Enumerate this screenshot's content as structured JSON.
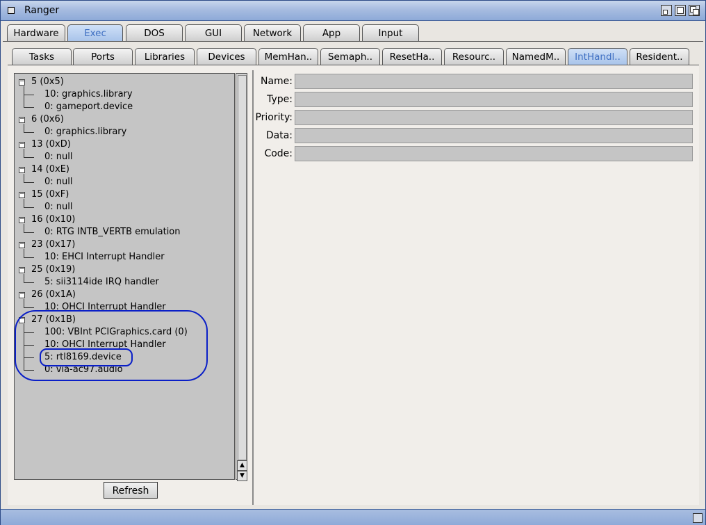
{
  "window": {
    "title": "Ranger"
  },
  "main_tabs": [
    {
      "label": "Hardware"
    },
    {
      "label": "Exec"
    },
    {
      "label": "DOS"
    },
    {
      "label": "GUI"
    },
    {
      "label": "Network"
    },
    {
      "label": "App"
    },
    {
      "label": "Input"
    }
  ],
  "sub_tabs": [
    {
      "label": "Tasks"
    },
    {
      "label": "Ports"
    },
    {
      "label": "Libraries"
    },
    {
      "label": "Devices"
    },
    {
      "label": "MemHan.."
    },
    {
      "label": "Semaph.."
    },
    {
      "label": "ResetHa.."
    },
    {
      "label": "Resourc.."
    },
    {
      "label": "NamedM.."
    },
    {
      "label": "IntHandl.."
    },
    {
      "label": "Resident.."
    }
  ],
  "tree": [
    {
      "label": "5 (0x5)",
      "children": [
        "10: graphics.library",
        "0: gameport.device"
      ]
    },
    {
      "label": "6 (0x6)",
      "children": [
        "0: graphics.library"
      ]
    },
    {
      "label": "13 (0xD)",
      "children": [
        "0: null"
      ]
    },
    {
      "label": "14 (0xE)",
      "children": [
        "0: null"
      ]
    },
    {
      "label": "15 (0xF)",
      "children": [
        "0: null"
      ]
    },
    {
      "label": "16 (0x10)",
      "children": [
        "0: RTG INTB_VERTB emulation"
      ]
    },
    {
      "label": "23 (0x17)",
      "children": [
        "10: EHCI Interrupt Handler"
      ]
    },
    {
      "label": "25 (0x19)",
      "children": [
        "5: sii3114ide IRQ handler"
      ]
    },
    {
      "label": "26 (0x1A)",
      "children": [
        "10: OHCI Interrupt Handler"
      ]
    },
    {
      "label": "27 (0x1B)",
      "children": [
        "100: VBInt PCIGraphics.card (0)",
        "10: OHCI Interrupt Handler",
        "5: rtl8169.device",
        "0: via-ac97.audio"
      ]
    }
  ],
  "refresh_label": "Refresh",
  "details": {
    "name_label": "Name:",
    "type_label": "Type:",
    "priority_label": "Priority:",
    "data_label": "Data:",
    "code_label": "Code:"
  },
  "colors": {
    "active_tab_text": "#3e6fc2",
    "annotation": "#0a1fc7"
  }
}
